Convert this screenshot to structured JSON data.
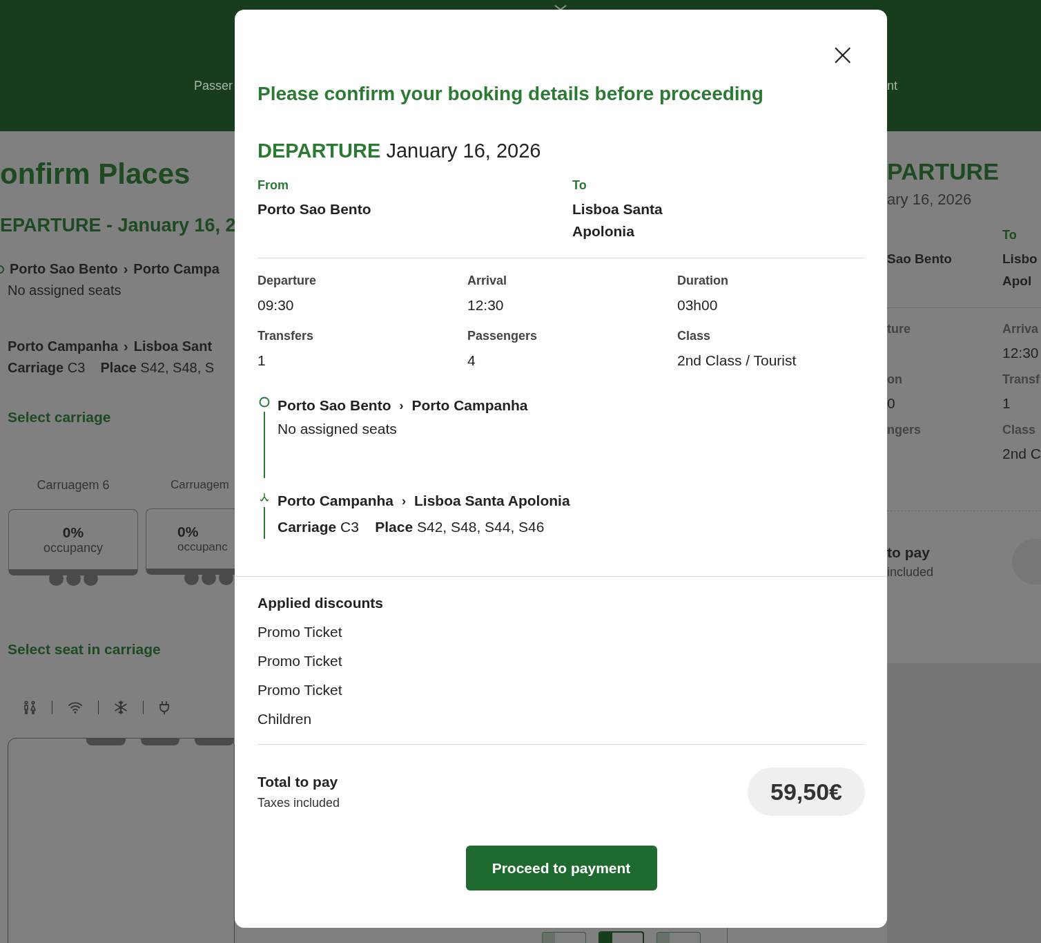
{
  "background": {
    "header": {
      "steps": [
        "Passer",
        "nt"
      ]
    },
    "left_panel": {
      "title": "onfirm Places",
      "departure": "EPARTURE - January 16, 2",
      "segments": [
        {
          "kind": "origin",
          "from": "Porto Sao Bento",
          "separator": "›",
          "to": "Porto Campa",
          "detail": "No assigned seats"
        },
        {
          "kind": "transfer",
          "from": "Porto Campanha",
          "separator": "›",
          "to": "Lisboa Sant",
          "carriage_label": "Carriage",
          "carriage": "C3",
          "place_label": "Place",
          "places": "S42, S48, S"
        }
      ],
      "select_carriage": "Select carriage",
      "carriages": [
        {
          "name": "Carruagem 6",
          "occupancy": "0%",
          "occupancy_label": "occupancy"
        },
        {
          "name": "Carruagem",
          "occupancy": "0%",
          "occupancy_label": "occupanc"
        }
      ],
      "select_seat": "Select seat in carriage"
    },
    "right_panel": {
      "heading": "PARTURE",
      "date": "ary 16, 2026",
      "to_label": "To",
      "from_value": "Sao Bento",
      "to_value": "Lisbo",
      "to_value_2": "Apol",
      "details": [
        {
          "label": "ture"
        },
        {
          "label": "Arriva",
          "value": "12:30"
        },
        {
          "label": "on",
          "value": "0"
        },
        {
          "label": "Transf",
          "value": "1"
        },
        {
          "label": "ngers"
        },
        {
          "label": "Class",
          "value": "2nd C"
        }
      ],
      "total_label": "to pay",
      "taxes": "included"
    }
  },
  "modal": {
    "close": "×",
    "title": "Please confirm your booking details before proceeding",
    "departure_label": "DEPARTURE",
    "departure_date": "January 16, 2026",
    "from_label": "From",
    "from": "Porto Sao Bento",
    "to_label": "To",
    "to": "Lisboa Santa Apolonia",
    "details": [
      {
        "label": "Departure",
        "value": "09:30"
      },
      {
        "label": "Arrival",
        "value": "12:30"
      },
      {
        "label": "Duration",
        "value": "03h00"
      },
      {
        "label": "Transfers",
        "value": "1"
      },
      {
        "label": "Passengers",
        "value": "4"
      },
      {
        "label": "Class",
        "value": "2nd Class / Tourist"
      }
    ],
    "segments": [
      {
        "kind": "origin",
        "from": "Porto Sao Bento",
        "separator": "›",
        "to": "Porto Campanha",
        "detail": "No assigned seats"
      },
      {
        "kind": "transfer",
        "from": "Porto Campanha",
        "separator": "›",
        "to": "Lisboa Santa Apolonia",
        "carriage_label": "Carriage",
        "carriage": "C3",
        "place_label": "Place",
        "places": "S42, S48, S44, S46"
      }
    ],
    "discounts_title": "Applied discounts",
    "discounts": [
      "Promo Ticket",
      "Promo Ticket",
      "Promo Ticket",
      "Children"
    ],
    "total_label": "Total to pay",
    "taxes": "Taxes included",
    "price": "59,50€",
    "proceed": "Proceed to payment"
  }
}
